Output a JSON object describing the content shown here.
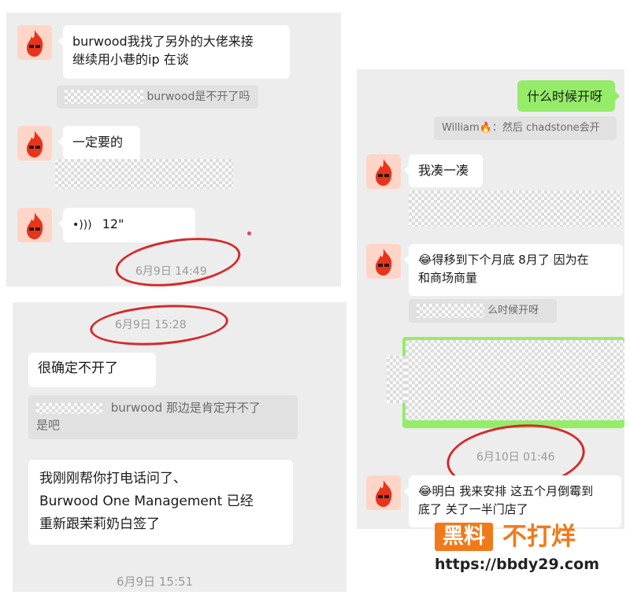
{
  "panel1": {
    "msg1_line1": "burwood我找了另外的大佬来接",
    "msg1_line2": "继续用小巷的ip 在谈",
    "quote1": "burwood是不开了吗",
    "msg2": "一定要的",
    "voice_duration": "12\"",
    "time": "6月9日 14:49"
  },
  "panel2": {
    "time_top": "6月9日 15:28",
    "msg1": "很确定不开了",
    "quote_line1": "burwood 那边是肯定开不了",
    "quote_line2": "是吧",
    "msg2_line1": "我刚刚帮你打电话问了、",
    "msg2_line2": "Burwood One Management 已经",
    "msg2_line3": "重新跟茉莉奶白签了",
    "time_bottom": "6月9日 15:51"
  },
  "panel3": {
    "sent_msg": "什么时候开呀",
    "quote_reply": "William🔥：然后 chadstone会开",
    "msg1": "我凑一凑",
    "msg2_line1": "😂得移到下个月底 8月了 因为在",
    "msg2_line2": "和商场商量",
    "quote2": "么时候开呀",
    "time": "6月10日 01:46",
    "msg3_line1": "😂明白 我来安排 这五个月倒霉到",
    "msg3_line2": "底了 关了一半门店了"
  },
  "watermark": {
    "brand_box": "黑料",
    "brand_text": "不打烊",
    "url": "https://bbdy29.com"
  },
  "colors": {
    "chat_bg": "#ededed",
    "sent_bubble": "#95ec69",
    "received_bubble": "#ffffff",
    "annotation_circle": "#d42a2a",
    "watermark_orange": "#f07a1a"
  }
}
